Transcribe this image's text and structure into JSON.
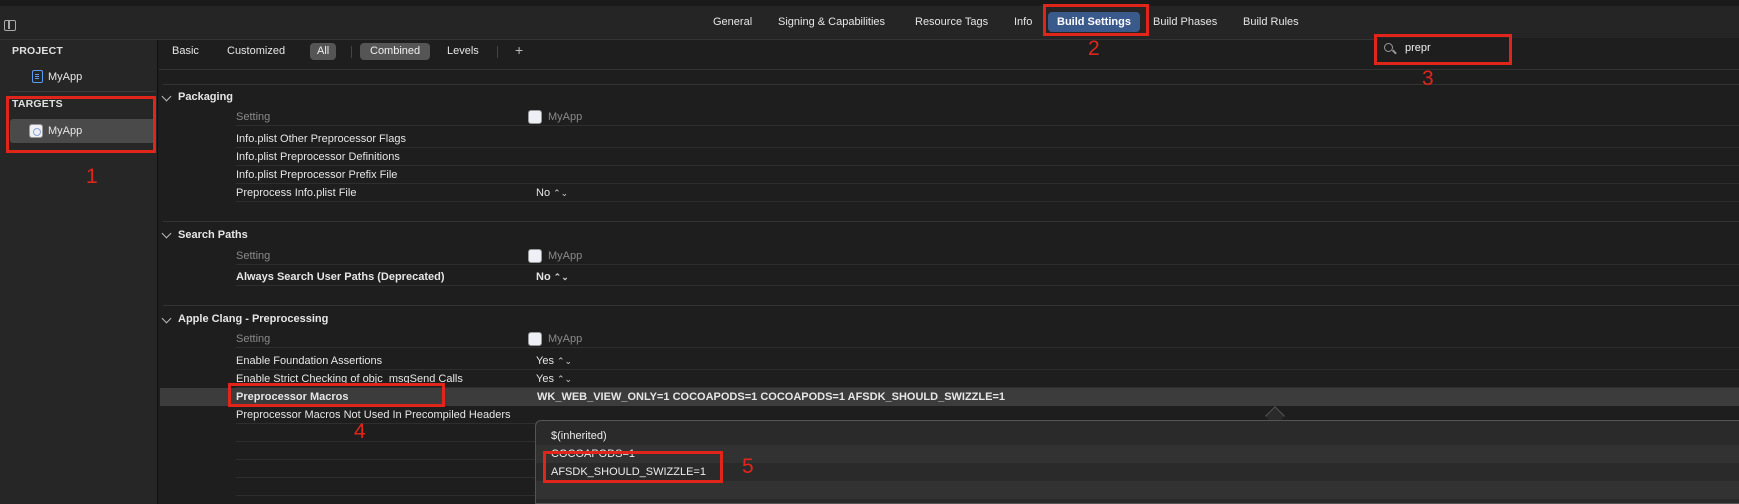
{
  "tabs": [
    "General",
    "Signing & Capabilities",
    "Resource Tags",
    "Info",
    "Build Settings",
    "Build Phases",
    "Build Rules"
  ],
  "active_tab": "Build Settings",
  "sidebar": {
    "project_header": "PROJECT",
    "project_item": "MyApp",
    "targets_header": "TARGETS",
    "target_item": "MyApp"
  },
  "toolbar": {
    "basic": "Basic",
    "customized": "Customized",
    "all": "All",
    "combined": "Combined",
    "levels": "Levels",
    "add": "+"
  },
  "search": {
    "value": "prepr"
  },
  "sections": {
    "packaging": {
      "title": "Packaging",
      "header_setting": "Setting",
      "header_target": "MyApp",
      "rows": [
        {
          "name": "Info.plist Other Preprocessor Flags",
          "value": ""
        },
        {
          "name": "Info.plist Preprocessor Definitions",
          "value": ""
        },
        {
          "name": "Info.plist Preprocessor Prefix File",
          "value": ""
        },
        {
          "name": "Preprocess Info.plist File",
          "value": "No"
        }
      ]
    },
    "search_paths": {
      "title": "Search Paths",
      "header_setting": "Setting",
      "header_target": "MyApp",
      "rows": [
        {
          "name": "Always Search User Paths (Deprecated)",
          "value": "No"
        }
      ]
    },
    "clang": {
      "title": "Apple Clang - Preprocessing",
      "header_setting": "Setting",
      "header_target": "MyApp",
      "rows": [
        {
          "name": "Enable Foundation Assertions",
          "value": "Yes"
        },
        {
          "name": "Enable Strict Checking of objc_msgSend Calls",
          "value": "Yes"
        },
        {
          "name": "Preprocessor Macros",
          "value": "WK_WEB_VIEW_ONLY=1 COCOAPODS=1 COCOAPODS=1 AFSDK_SHOULD_SWIZZLE=1"
        },
        {
          "name": "Preprocessor Macros Not Used In Precompiled Headers",
          "value": ""
        }
      ]
    }
  },
  "popup": {
    "lines": [
      "$(inherited)",
      "COCOAPODS=1",
      "AFSDK_SHOULD_SWIZZLE=1"
    ]
  },
  "annotations": {
    "colors": {
      "callout": "#e0261b"
    },
    "labels": [
      "1",
      "2",
      "3",
      "4",
      "5"
    ]
  }
}
